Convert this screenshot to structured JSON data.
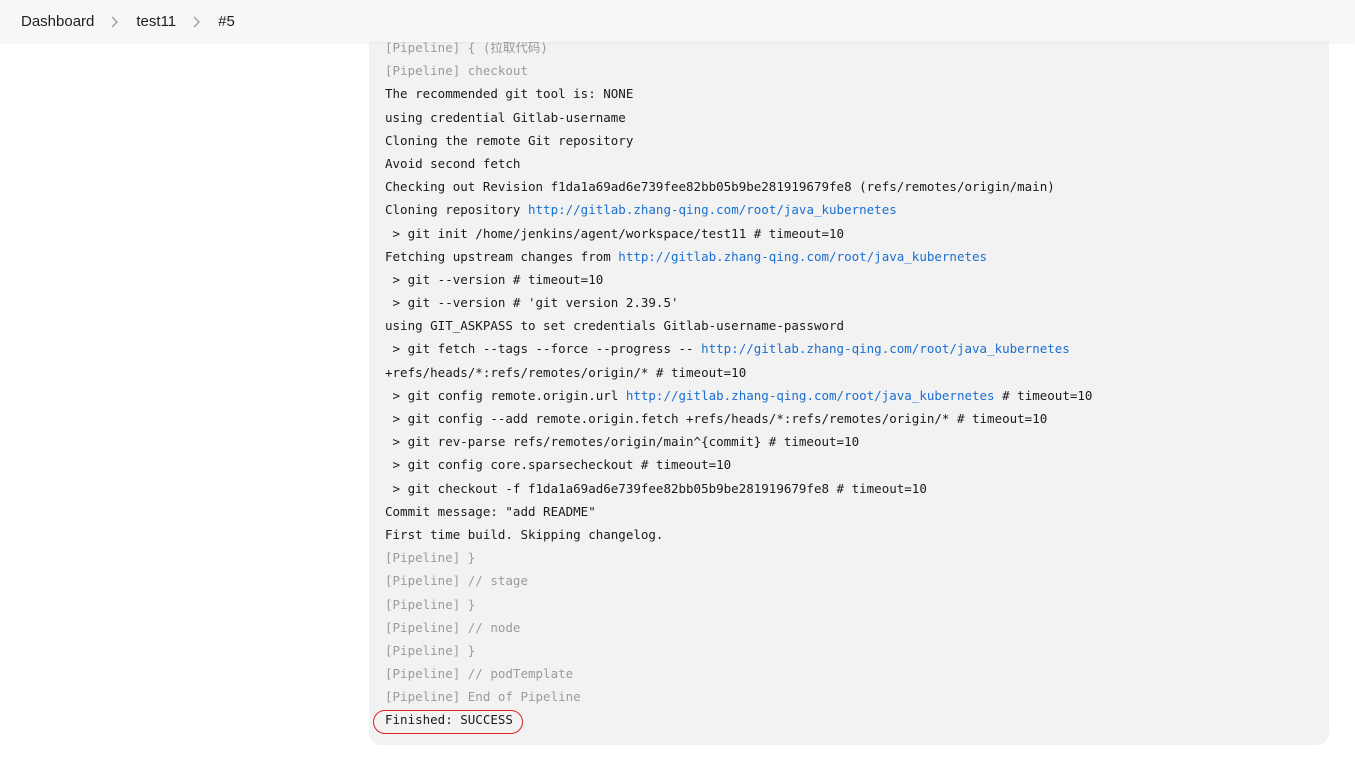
{
  "breadcrumb": {
    "items": [
      "Dashboard",
      "test11",
      "#5"
    ]
  },
  "console": {
    "lines": [
      {
        "kind": "pipeline",
        "parts": [
          {
            "t": "[Pipeline] { (拉取代码)"
          }
        ]
      },
      {
        "kind": "pipeline",
        "parts": [
          {
            "t": "[Pipeline] checkout"
          }
        ]
      },
      {
        "kind": "plain",
        "parts": [
          {
            "t": "The recommended git tool is: NONE"
          }
        ]
      },
      {
        "kind": "plain",
        "parts": [
          {
            "t": "using credential Gitlab-username"
          }
        ]
      },
      {
        "kind": "plain",
        "parts": [
          {
            "t": "Cloning the remote Git repository"
          }
        ]
      },
      {
        "kind": "plain",
        "parts": [
          {
            "t": "Avoid second fetch"
          }
        ]
      },
      {
        "kind": "plain",
        "parts": [
          {
            "t": "Checking out Revision f1da1a69ad6e739fee82bb05b9be281919679fe8 (refs/remotes/origin/main)"
          }
        ]
      },
      {
        "kind": "plain",
        "parts": [
          {
            "t": "Cloning repository "
          },
          {
            "t": "http://gitlab.zhang-qing.com/root/java_kubernetes",
            "link": true
          }
        ]
      },
      {
        "kind": "plain",
        "parts": [
          {
            "t": " > git init /home/jenkins/agent/workspace/test11 # timeout=10"
          }
        ]
      },
      {
        "kind": "plain",
        "parts": [
          {
            "t": "Fetching upstream changes from "
          },
          {
            "t": "http://gitlab.zhang-qing.com/root/java_kubernetes",
            "link": true
          }
        ]
      },
      {
        "kind": "plain",
        "parts": [
          {
            "t": " > git --version # timeout=10"
          }
        ]
      },
      {
        "kind": "plain",
        "parts": [
          {
            "t": " > git --version # 'git version 2.39.5'"
          }
        ]
      },
      {
        "kind": "plain",
        "parts": [
          {
            "t": "using GIT_ASKPASS to set credentials Gitlab-username-password"
          }
        ]
      },
      {
        "kind": "plain",
        "parts": [
          {
            "t": " > git fetch --tags --force --progress -- "
          },
          {
            "t": "http://gitlab.zhang-qing.com/root/java_kubernetes",
            "link": true
          }
        ]
      },
      {
        "kind": "plain",
        "parts": [
          {
            "t": "+refs/heads/*:refs/remotes/origin/* # timeout=10"
          }
        ]
      },
      {
        "kind": "plain",
        "parts": [
          {
            "t": " > git config remote.origin.url "
          },
          {
            "t": "http://gitlab.zhang-qing.com/root/java_kubernetes",
            "link": true
          },
          {
            "t": " # timeout=10"
          }
        ]
      },
      {
        "kind": "plain",
        "parts": [
          {
            "t": " > git config --add remote.origin.fetch +refs/heads/*:refs/remotes/origin/* # timeout=10"
          }
        ]
      },
      {
        "kind": "plain",
        "parts": [
          {
            "t": " > git rev-parse refs/remotes/origin/main^{commit} # timeout=10"
          }
        ]
      },
      {
        "kind": "plain",
        "parts": [
          {
            "t": " > git config core.sparsecheckout # timeout=10"
          }
        ]
      },
      {
        "kind": "plain",
        "parts": [
          {
            "t": " > git checkout -f f1da1a69ad6e739fee82bb05b9be281919679fe8 # timeout=10"
          }
        ]
      },
      {
        "kind": "plain",
        "parts": [
          {
            "t": "Commit message: \"add README\""
          }
        ]
      },
      {
        "kind": "plain",
        "parts": [
          {
            "t": "First time build. Skipping changelog."
          }
        ]
      },
      {
        "kind": "pipeline",
        "parts": [
          {
            "t": "[Pipeline] }"
          }
        ]
      },
      {
        "kind": "pipeline",
        "parts": [
          {
            "t": "[Pipeline] // stage"
          }
        ]
      },
      {
        "kind": "pipeline",
        "parts": [
          {
            "t": "[Pipeline] }"
          }
        ]
      },
      {
        "kind": "pipeline",
        "parts": [
          {
            "t": "[Pipeline] // node"
          }
        ]
      },
      {
        "kind": "pipeline",
        "parts": [
          {
            "t": "[Pipeline] }"
          }
        ]
      },
      {
        "kind": "pipeline",
        "parts": [
          {
            "t": "[Pipeline] // podTemplate"
          }
        ]
      },
      {
        "kind": "pipeline",
        "parts": [
          {
            "t": "[Pipeline] End of Pipeline"
          }
        ]
      },
      {
        "kind": "result",
        "parts": [
          {
            "t": "Finished: SUCCESS"
          }
        ]
      }
    ]
  },
  "colors": {
    "link": "#1a6fd1",
    "pipeline_text": "#9a9aa0",
    "highlight_ring": "#d9262c",
    "console_bg": "#f2f2f3"
  },
  "icons": {
    "breadcrumb_separator": "chevron-right-icon"
  }
}
